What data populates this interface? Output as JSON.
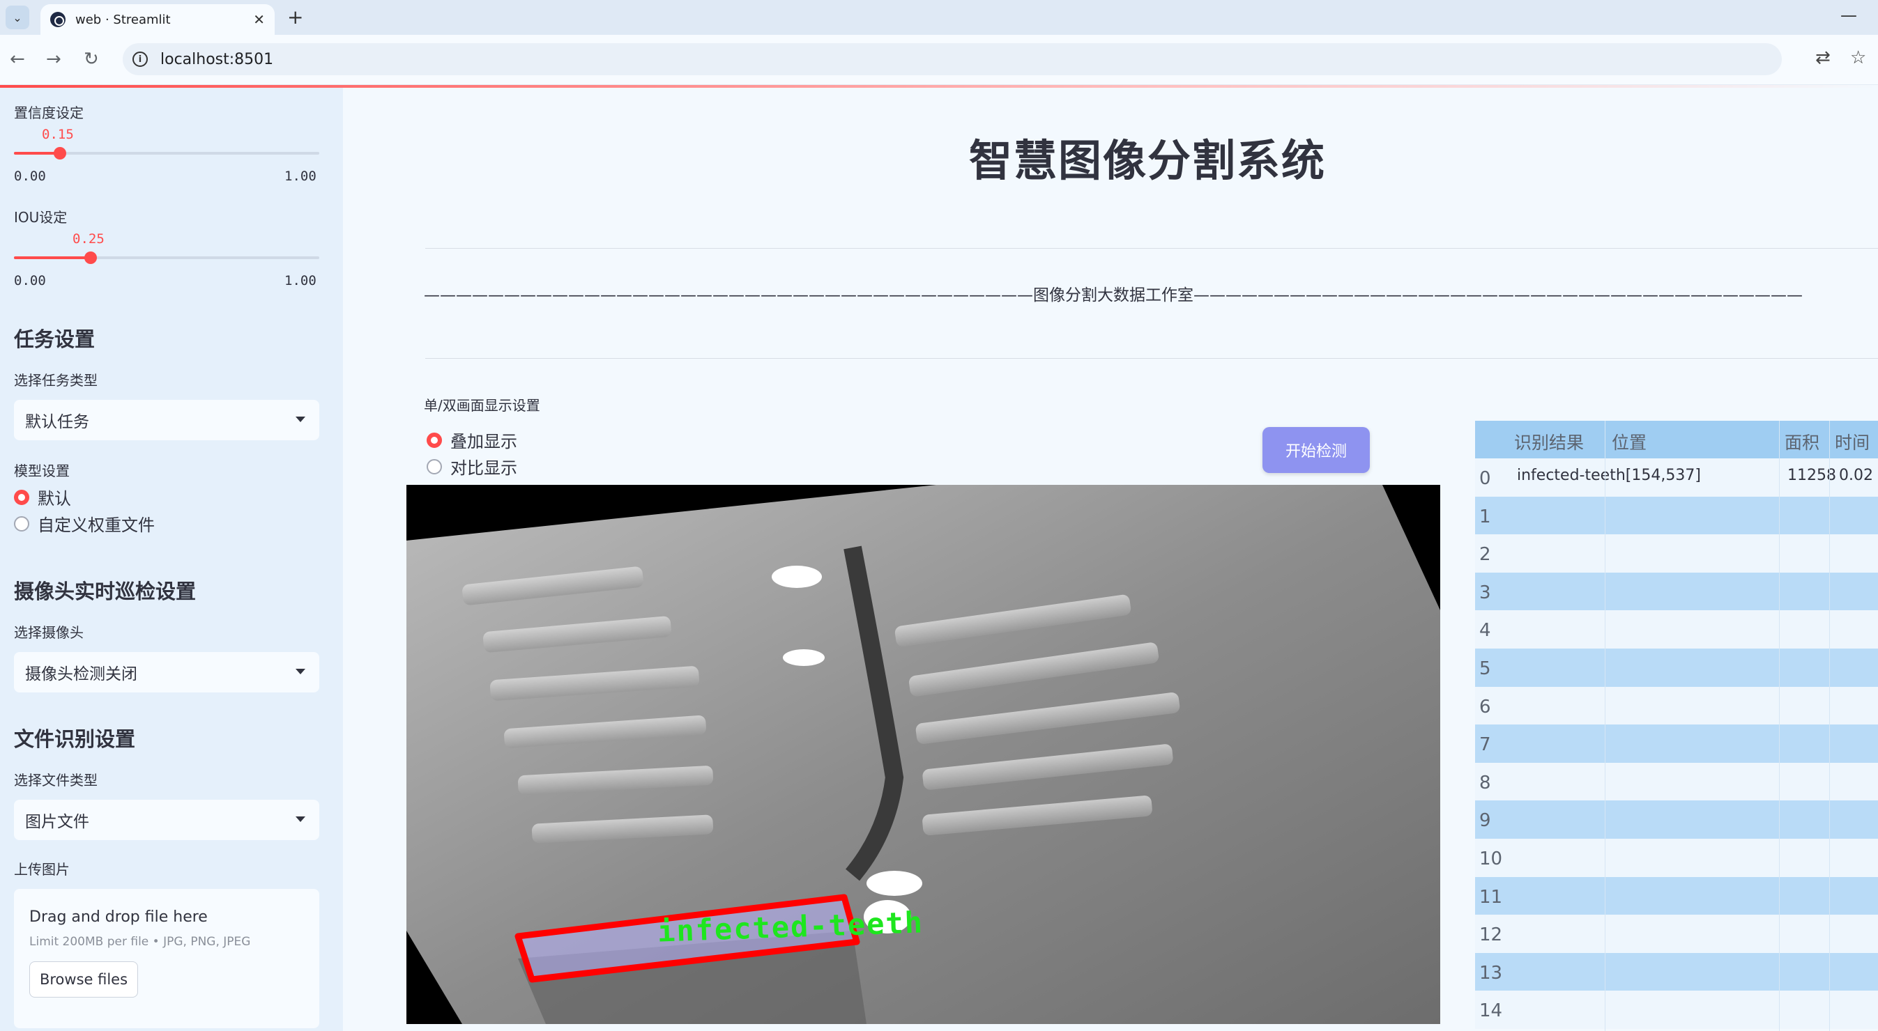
{
  "browser": {
    "tab_title": "web · Streamlit",
    "url": "localhost:8501"
  },
  "sidebar": {
    "confidence": {
      "label": "置信度设定",
      "value": "0.15",
      "min": "0.00",
      "max": "1.00",
      "fraction": 0.15
    },
    "iou": {
      "label": "IOU设定",
      "value": "0.25",
      "min": "0.00",
      "max": "1.00",
      "fraction": 0.25
    },
    "task_settings": {
      "heading": "任务设置",
      "select_label": "选择任务类型",
      "selected": "默认任务"
    },
    "model_settings": {
      "label": "模型设置",
      "options": [
        "默认",
        "自定义权重文件"
      ],
      "selected_index": 0
    },
    "camera": {
      "heading": "摄像头实时巡检设置",
      "select_label": "选择摄像头",
      "selected": "摄像头检测关闭"
    },
    "file": {
      "heading": "文件识别设置",
      "select_label": "选择文件类型",
      "selected": "图片文件",
      "upload_label": "上传图片"
    },
    "uploader": {
      "title": "Drag and drop file here",
      "limit": "Limit 200MB per file • JPG, PNG, JPEG",
      "button": "Browse files"
    }
  },
  "main": {
    "title": "智慧图像分割系统",
    "divider_text": "——————————————————————————————————————图像分割大数据工作室——————————————————————————————————————",
    "display_mode": {
      "label": "单/双画面显示设置",
      "options": [
        "叠加显示",
        "对比显示"
      ],
      "selected_index": 0
    },
    "start_button": "开始检测",
    "detection_label": "infected-teeth"
  },
  "results": {
    "columns": [
      "识别结果",
      "位置",
      "面积",
      "时间"
    ],
    "rows": [
      {
        "index": "0",
        "result": "infected-teeth",
        "position": "[154,537]",
        "area": "11258",
        "time": "0.02"
      },
      {
        "index": "1"
      },
      {
        "index": "2"
      },
      {
        "index": "3"
      },
      {
        "index": "4"
      },
      {
        "index": "5"
      },
      {
        "index": "6"
      },
      {
        "index": "7"
      },
      {
        "index": "8"
      },
      {
        "index": "9"
      },
      {
        "index": "10"
      },
      {
        "index": "11"
      },
      {
        "index": "12"
      },
      {
        "index": "13"
      },
      {
        "index": "14"
      }
    ]
  },
  "colors": {
    "accent": "#ff4b4b",
    "button": "#8e93f0",
    "table_header": "#9fcdf2",
    "detection_box": "#ff0000",
    "detection_text": "#1ee61e"
  }
}
